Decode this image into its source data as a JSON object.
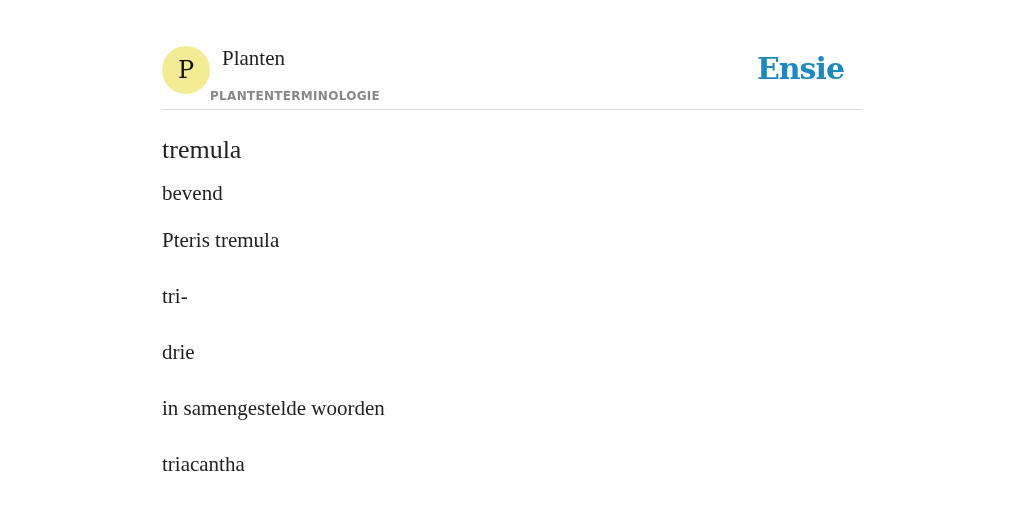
{
  "header": {
    "avatar_letter": "P",
    "title": "Planten",
    "subtitle": "PLANTENTERMINOLOGIE",
    "brand": "Ensie"
  },
  "heading": "tremula",
  "lines": [
    "bevend",
    "Pteris tremula",
    "tri-",
    "drie",
    "in samengestelde woorden",
    "triacantha"
  ]
}
